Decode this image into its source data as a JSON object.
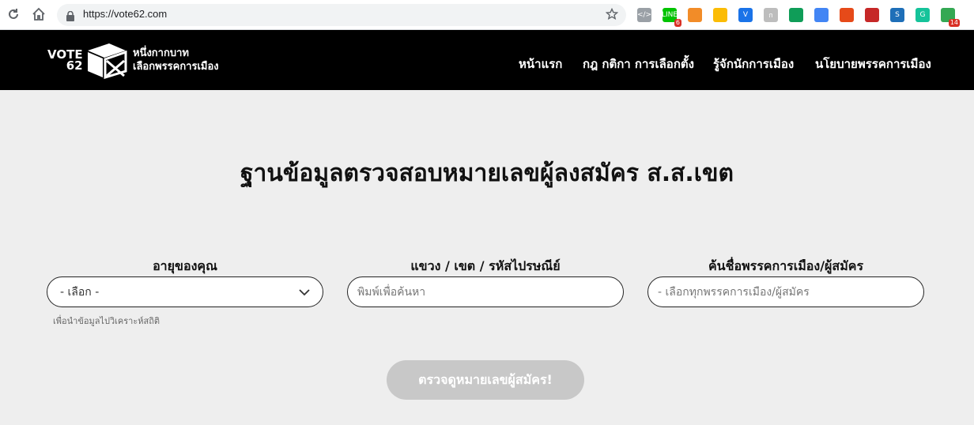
{
  "browser": {
    "url": "https://vote62.com",
    "extensions": [
      {
        "name": "code-ext-icon",
        "glyph": "</>",
        "color": "#9aa0a6"
      },
      {
        "name": "line-ext-icon",
        "glyph": "LINE",
        "color": "#00c300",
        "badge": "6"
      },
      {
        "name": "basketball-ext-icon",
        "glyph": "",
        "color": "#f28c28"
      },
      {
        "name": "grid-ext-icon",
        "glyph": "",
        "color": "#fbbc05"
      },
      {
        "name": "v-ext-icon",
        "glyph": "V",
        "color": "#1a73e8"
      },
      {
        "name": "thai-ext-icon",
        "glyph": "ก",
        "color": "#bdbdbd"
      },
      {
        "name": "google-drive-icon",
        "glyph": "",
        "color": "#0f9d58"
      },
      {
        "name": "compass-ext-icon",
        "glyph": "",
        "color": "#4285f4"
      },
      {
        "name": "office-ext-icon",
        "glyph": "",
        "color": "#e64a19"
      },
      {
        "name": "pdf-ext-icon",
        "glyph": "",
        "color": "#c62828"
      },
      {
        "name": "s-ext-icon",
        "glyph": "S",
        "color": "#1e6fb8"
      },
      {
        "name": "grammarly-icon",
        "glyph": "G",
        "color": "#15c39a"
      },
      {
        "name": "mail-ext-icon",
        "glyph": "",
        "color": "#34a853",
        "badge": "14"
      }
    ]
  },
  "header": {
    "logo_vote": "VOTE",
    "logo_62": "62",
    "logo_line1": "หนึ่งกากบาท",
    "logo_line2": "เลือกพรรคการเมือง",
    "menu": [
      "หน้าแรก",
      "กฎ กติกา การเลือกตั้ง",
      "รู้จักนักการเมือง",
      "นโยบายพรรคการเมือง"
    ]
  },
  "main": {
    "title": "ฐานข้อมูลตรวจสอบหมายเลขผู้ลงสมัคร ส.ส.เขต",
    "age_label": "อายุของคุณ",
    "age_select_value": "- เลือก -",
    "age_hint": "เพื่อนำข้อมูลไปวิเคราะห์สถิติ",
    "area_label": "แขวง / เขต / รหัสไปรษณีย์",
    "area_placeholder": "พิมพ์เพื่อค้นหา",
    "party_label": "ค้นชื่อพรรคการเมือง/ผู้สมัคร",
    "party_placeholder": "- เลือกทุกพรรคการเมือง/ผู้สมัคร",
    "submit_label": "ตรวจดูหมายเลขผู้สมัคร!"
  }
}
